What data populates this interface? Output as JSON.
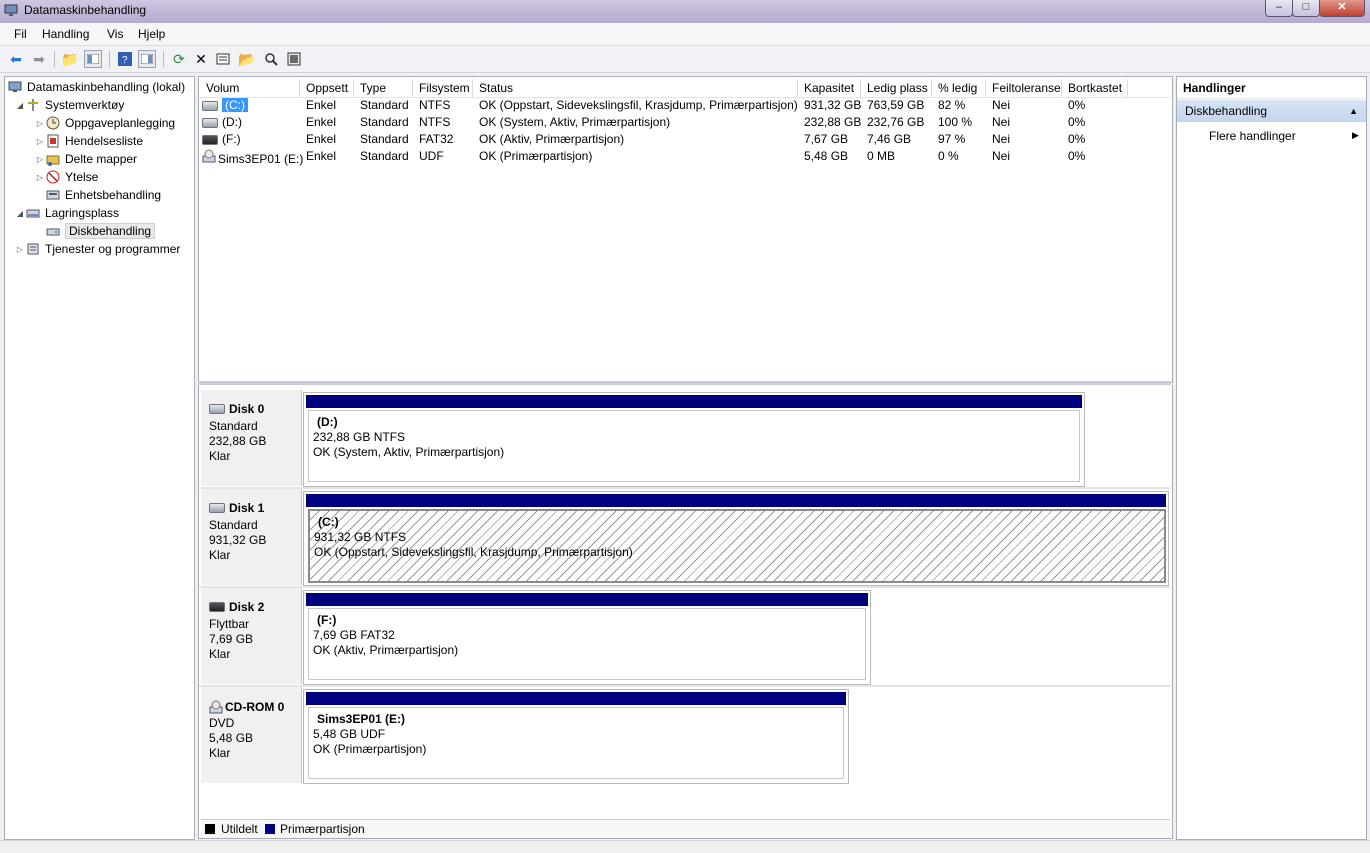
{
  "window": {
    "title": "Datamaskinbehandling",
    "min": "–",
    "max": "□",
    "close": "✕"
  },
  "menu": [
    "Fil",
    "Handling",
    "Vis",
    "Hjelp"
  ],
  "tree": {
    "root": "Datamaskinbehandling (lokal)",
    "systemtools": "Systemverktøy",
    "scheduler": "Oppgaveplanlegging",
    "eventviewer": "Hendelsesliste",
    "shared": "Delte mapper",
    "performance": "Ytelse",
    "devmgr": "Enhetsbehandling",
    "storage": "Lagringsplass",
    "diskmgmt": "Diskbehandling",
    "services": "Tjenester og programmer"
  },
  "columns": [
    "Volum",
    "Oppsett",
    "Type",
    "Filsystem",
    "Status",
    "Kapasitet",
    "Ledig plass",
    "% ledig",
    "Feiltoleranse",
    "Bortkastet"
  ],
  "volumes": [
    {
      "volume": "(C:)",
      "layout": "Enkel",
      "type": "Standard",
      "fs": "NTFS",
      "status": "OK (Oppstart, Sidevekslingsfil, Krasjdump, Primærpartisjon)",
      "capacity": "931,32 GB",
      "free": "763,59 GB",
      "pct": "82 %",
      "ft": "Nei",
      "overhead": "0%"
    },
    {
      "volume": "(D:)",
      "layout": "Enkel",
      "type": "Standard",
      "fs": "NTFS",
      "status": "OK (System, Aktiv, Primærpartisjon)",
      "capacity": "232,88 GB",
      "free": "232,76 GB",
      "pct": "100 %",
      "ft": "Nei",
      "overhead": "0%"
    },
    {
      "volume": "(F:)",
      "layout": "Enkel",
      "type": "Standard",
      "fs": "FAT32",
      "status": "OK (Aktiv, Primærpartisjon)",
      "capacity": "7,67 GB",
      "free": "7,46 GB",
      "pct": "97 %",
      "ft": "Nei",
      "overhead": "0%"
    },
    {
      "volume": "Sims3EP01 (E:)",
      "layout": "Enkel",
      "type": "Standard",
      "fs": "UDF",
      "status": "OK (Primærpartisjon)",
      "capacity": "5,48 GB",
      "free": "0 MB",
      "pct": "0 %",
      "ft": "Nei",
      "overhead": "0%"
    }
  ],
  "disks": [
    {
      "name": "Disk 0",
      "kind": "Standard",
      "size": "232,88 GB",
      "state": "Klar",
      "part_name": "(D:)",
      "part_size": "232,88 GB NTFS",
      "part_status": "OK (System, Aktiv, Primærpartisjon)"
    },
    {
      "name": "Disk 1",
      "kind": "Standard",
      "size": "931,32 GB",
      "state": "Klar",
      "part_name": "(C:)",
      "part_size": "931,32 GB NTFS",
      "part_status": "OK (Oppstart, Sidevekslingsfil, Krasjdump, Primærpartisjon)"
    },
    {
      "name": "Disk 2",
      "kind": "Flyttbar",
      "size": "7,69 GB",
      "state": "Klar",
      "part_name": "(F:)",
      "part_size": "7,69 GB FAT32",
      "part_status": "OK (Aktiv, Primærpartisjon)"
    },
    {
      "name": "CD-ROM 0",
      "kind": "DVD",
      "size": "5,48 GB",
      "state": "Klar",
      "part_name": "Sims3EP01  (E:)",
      "part_size": "5,48 GB UDF",
      "part_status": "OK (Primærpartisjon)"
    }
  ],
  "legend": {
    "unallocated": "Utildelt",
    "primary": "Primærpartisjon",
    "unallocated_color": "#000000",
    "primary_color": "#00007f"
  },
  "actions": {
    "header": "Handlinger",
    "group": "Diskbehandling",
    "more": "Flere handlinger"
  }
}
